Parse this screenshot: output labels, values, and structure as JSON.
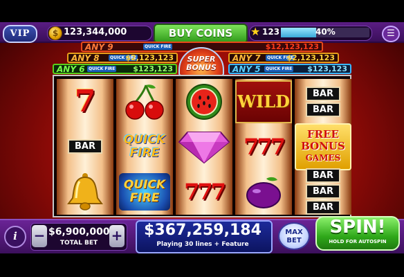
{
  "top_bar": {
    "vip_label": "VIP",
    "coin_balance": "123,344,000",
    "buy_coins_label": "BUY COINS",
    "level": "123",
    "level_progress_percent": "40%",
    "level_progress_value": 0.4
  },
  "jackpots": [
    {
      "label": "ANY 9",
      "qf": "QUICK FIRE",
      "amount": "$12,123,123"
    },
    {
      "label": "ANY 8",
      "qf": "QUICK FIRE",
      "amount": "$2,123,123"
    },
    {
      "label": "ANY 7",
      "qf": "QUICK FIRE",
      "amount": "$2,123,123"
    },
    {
      "label": "ANY 6",
      "qf": "QUICK FIRE",
      "amount": "$123,123"
    },
    {
      "label": "ANY 5",
      "qf": "QUICK FIRE",
      "amount": "$123,123"
    }
  ],
  "super_bonus": {
    "line1": "SUPER",
    "line2": "BONUS"
  },
  "reels": [
    [
      "seven",
      "bar",
      "bell"
    ],
    [
      "cherries",
      "quick-fire",
      "quick-fire-tile"
    ],
    [
      "watermelon",
      "diamond",
      "triple-seven"
    ],
    [
      "wild",
      "triple-seven",
      "plum"
    ],
    [
      "double-bar",
      "free-bonus-games",
      "triple-bar"
    ]
  ],
  "symbols": {
    "seven": "7",
    "bar": "BAR",
    "wild": "WILD",
    "quick": "QUICK",
    "fire": "FIRE",
    "free": "FREE",
    "bonus": "BONUS",
    "games": "GAMES",
    "triple_seven": "777"
  },
  "bottom_bar": {
    "info_label": "i",
    "minus_label": "−",
    "plus_label": "+",
    "total_bet": "$6,900,000",
    "total_bet_label": "TOTAL BET",
    "win_amount": "$367,259,184",
    "win_subtitle": "Playing 30 lines + Feature",
    "max_bet_line1": "MAX",
    "max_bet_line2": "BET",
    "spin_label": "SPIN!",
    "spin_subtitle": "HOLD FOR AUTOSPIN"
  },
  "colors": {
    "accent_purple": "#5a1d83",
    "buy_green": "#2f9a1a",
    "spin_green": "#2fa81a",
    "jackpot_red": "#e01010"
  }
}
